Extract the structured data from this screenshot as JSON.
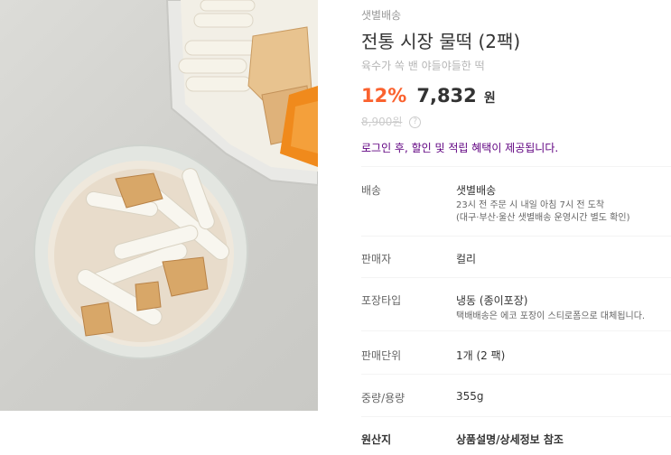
{
  "product": {
    "delivery_tag": "샛별배송",
    "title": "전통 시장 물떡 (2팩)",
    "subtitle": "육수가 쏙 밴 야들야들한 떡",
    "discount": "12%",
    "price": "7,832",
    "price_unit": "원",
    "original_price": "8,900원",
    "help_icon": "?",
    "login_message": "로그인 후, 할인 및 적립 혜택이 제공됩니다."
  },
  "details": [
    {
      "label": "배송",
      "value": "샛별배송",
      "sub": [
        "23시 전 주문 시 내일 아침 7시 전 도착",
        "(대구·부산·울산 샛별배송 운영시간 별도 확인)"
      ]
    },
    {
      "label": "판매자",
      "value": "컬리"
    },
    {
      "label": "포장타입",
      "value": "냉동 (종이포장)",
      "sub": [
        "택배배송은 에코 포장이 스티로폼으로 대체됩니다."
      ]
    },
    {
      "label": "판매단위",
      "value": "1개 (2 팩)"
    },
    {
      "label": "중량/용량",
      "value": "355g"
    },
    {
      "label": "원산지",
      "value": "상품설명/상세정보 참조"
    }
  ],
  "colors": {
    "accent": "#fa622f",
    "brand": "#5f0080"
  }
}
